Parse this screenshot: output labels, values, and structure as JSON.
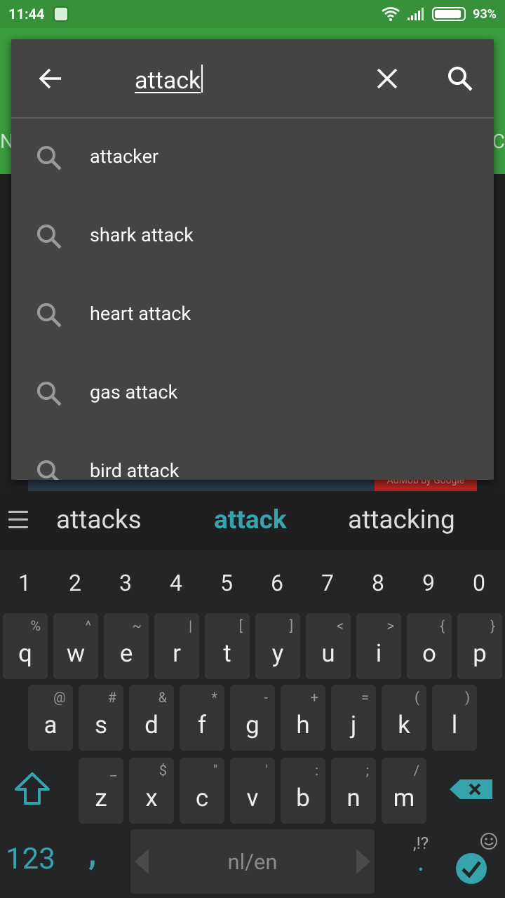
{
  "status_bar": {
    "time": "11:44",
    "battery": "93%"
  },
  "background_app": {
    "left_edge_text": "N",
    "right_edge_text": "C",
    "ad_label": "AdMob by Google"
  },
  "search": {
    "query": "attack",
    "suggestions": [
      "attacker",
      "shark attack",
      "heart attack",
      "gas attack",
      "bird attack"
    ]
  },
  "keyboard": {
    "word_suggestions": {
      "left": "attacks",
      "center": "attack",
      "right": "attacking"
    },
    "numbers": [
      "1",
      "2",
      "3",
      "4",
      "5",
      "6",
      "7",
      "8",
      "9",
      "0"
    ],
    "row1": [
      {
        "key": "q",
        "hint": "%"
      },
      {
        "key": "w",
        "hint": "^"
      },
      {
        "key": "e",
        "hint": "~"
      },
      {
        "key": "r",
        "hint": "|"
      },
      {
        "key": "t",
        "hint": "["
      },
      {
        "key": "y",
        "hint": "]"
      },
      {
        "key": "u",
        "hint": "<"
      },
      {
        "key": "i",
        "hint": ">"
      },
      {
        "key": "o",
        "hint": "{"
      },
      {
        "key": "p",
        "hint": "}"
      }
    ],
    "row2": [
      {
        "key": "a",
        "hint": "@"
      },
      {
        "key": "s",
        "hint": "#"
      },
      {
        "key": "d",
        "hint": "&"
      },
      {
        "key": "f",
        "hint": "*"
      },
      {
        "key": "g",
        "hint": "-"
      },
      {
        "key": "h",
        "hint": "+"
      },
      {
        "key": "j",
        "hint": "="
      },
      {
        "key": "k",
        "hint": "("
      },
      {
        "key": "l",
        "hint": ")"
      }
    ],
    "row3": [
      {
        "key": "z",
        "hint": "_"
      },
      {
        "key": "x",
        "hint": "$"
      },
      {
        "key": "c",
        "hint": "\""
      },
      {
        "key": "v",
        "hint": "'"
      },
      {
        "key": "b",
        "hint": ":"
      },
      {
        "key": "n",
        "hint": ";"
      },
      {
        "key": "m",
        "hint": "/"
      }
    ],
    "numbers_key": "123",
    "comma_key": ",",
    "space_label": "nl/en",
    "punct_key": ",!?",
    "punct_dot": "."
  },
  "colors": {
    "status_green": "#37913a",
    "accent_teal": "#36a3ad",
    "sheet_bg": "#444444"
  }
}
